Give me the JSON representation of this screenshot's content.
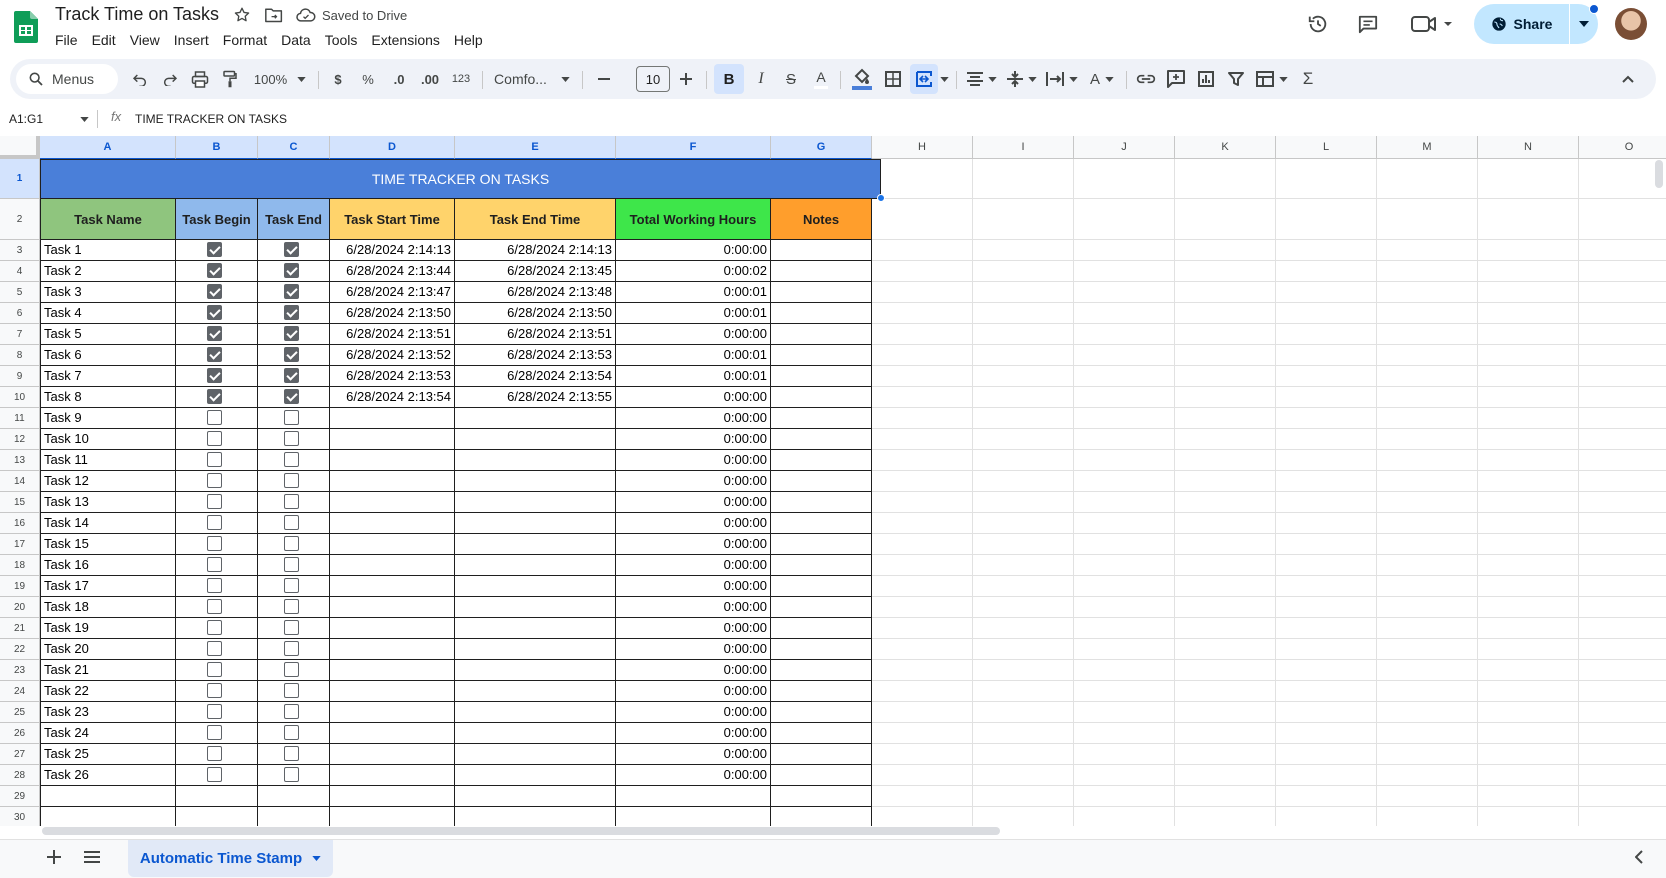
{
  "app": {
    "title": "Track Time on Tasks",
    "save_status": "Saved to Drive",
    "menus": [
      "File",
      "Edit",
      "View",
      "Insert",
      "Format",
      "Data",
      "Tools",
      "Extensions",
      "Help"
    ],
    "share_label": "Share"
  },
  "toolbar": {
    "search_label": "Menus",
    "zoom": "100%",
    "currency": "$",
    "percent": "%",
    "decrease_decimal": ".0",
    "increase_decimal": ".00",
    "number_format": "123",
    "font": "Comfo...",
    "font_size": "10"
  },
  "formula_bar": {
    "name_box": "A1:G1",
    "fx": "fx",
    "formula": "TIME TRACKER ON TASKS"
  },
  "columns": [
    "A",
    "B",
    "C",
    "D",
    "E",
    "F",
    "G",
    "H",
    "I",
    "J",
    "K",
    "L",
    "M",
    "N",
    "O"
  ],
  "row_numbers": [
    "1",
    "2",
    "3",
    "4",
    "5",
    "6",
    "7",
    "8",
    "9",
    "10",
    "11",
    "12",
    "13",
    "14",
    "15",
    "16",
    "17",
    "18",
    "19",
    "20",
    "21",
    "22",
    "23",
    "24",
    "25",
    "26",
    "27",
    "28",
    "29",
    "30"
  ],
  "sheet": {
    "title": "TIME TRACKER ON TASKS",
    "headers": [
      "Task Name",
      "Task Begin",
      "Task End",
      "Task Start Time",
      "Task End Time",
      "Total Working Hours",
      "Notes"
    ],
    "header_colors": [
      "#8fc57e",
      "#8fb9ec",
      "#8fb9ec",
      "#ffd36b",
      "#ffd36b",
      "#3ee64a",
      "#ff9e2c"
    ],
    "rows": [
      {
        "name": "Task 1",
        "begin": true,
        "end": true,
        "start": "6/28/2024 2:14:13",
        "endtime": "6/28/2024 2:14:13",
        "total": "0:00:00",
        "notes": ""
      },
      {
        "name": "Task 2",
        "begin": true,
        "end": true,
        "start": "6/28/2024 2:13:44",
        "endtime": "6/28/2024 2:13:45",
        "total": "0:00:02",
        "notes": ""
      },
      {
        "name": "Task 3",
        "begin": true,
        "end": true,
        "start": "6/28/2024 2:13:47",
        "endtime": "6/28/2024 2:13:48",
        "total": "0:00:01",
        "notes": ""
      },
      {
        "name": "Task 4",
        "begin": true,
        "end": true,
        "start": "6/28/2024 2:13:50",
        "endtime": "6/28/2024 2:13:50",
        "total": "0:00:01",
        "notes": ""
      },
      {
        "name": "Task 5",
        "begin": true,
        "end": true,
        "start": "6/28/2024 2:13:51",
        "endtime": "6/28/2024 2:13:51",
        "total": "0:00:00",
        "notes": ""
      },
      {
        "name": "Task 6",
        "begin": true,
        "end": true,
        "start": "6/28/2024 2:13:52",
        "endtime": "6/28/2024 2:13:53",
        "total": "0:00:01",
        "notes": ""
      },
      {
        "name": "Task 7",
        "begin": true,
        "end": true,
        "start": "6/28/2024 2:13:53",
        "endtime": "6/28/2024 2:13:54",
        "total": "0:00:01",
        "notes": ""
      },
      {
        "name": "Task 8",
        "begin": true,
        "end": true,
        "start": "6/28/2024 2:13:54",
        "endtime": "6/28/2024 2:13:55",
        "total": "0:00:00",
        "notes": ""
      },
      {
        "name": "Task 9",
        "begin": false,
        "end": false,
        "start": "",
        "endtime": "",
        "total": "0:00:00",
        "notes": ""
      },
      {
        "name": "Task 10",
        "begin": false,
        "end": false,
        "start": "",
        "endtime": "",
        "total": "0:00:00",
        "notes": ""
      },
      {
        "name": "Task 11",
        "begin": false,
        "end": false,
        "start": "",
        "endtime": "",
        "total": "0:00:00",
        "notes": ""
      },
      {
        "name": "Task 12",
        "begin": false,
        "end": false,
        "start": "",
        "endtime": "",
        "total": "0:00:00",
        "notes": ""
      },
      {
        "name": "Task 13",
        "begin": false,
        "end": false,
        "start": "",
        "endtime": "",
        "total": "0:00:00",
        "notes": ""
      },
      {
        "name": "Task 14",
        "begin": false,
        "end": false,
        "start": "",
        "endtime": "",
        "total": "0:00:00",
        "notes": ""
      },
      {
        "name": "Task 15",
        "begin": false,
        "end": false,
        "start": "",
        "endtime": "",
        "total": "0:00:00",
        "notes": ""
      },
      {
        "name": "Task 16",
        "begin": false,
        "end": false,
        "start": "",
        "endtime": "",
        "total": "0:00:00",
        "notes": ""
      },
      {
        "name": "Task 17",
        "begin": false,
        "end": false,
        "start": "",
        "endtime": "",
        "total": "0:00:00",
        "notes": ""
      },
      {
        "name": "Task 18",
        "begin": false,
        "end": false,
        "start": "",
        "endtime": "",
        "total": "0:00:00",
        "notes": ""
      },
      {
        "name": "Task 19",
        "begin": false,
        "end": false,
        "start": "",
        "endtime": "",
        "total": "0:00:00",
        "notes": ""
      },
      {
        "name": "Task 20",
        "begin": false,
        "end": false,
        "start": "",
        "endtime": "",
        "total": "0:00:00",
        "notes": ""
      },
      {
        "name": "Task 21",
        "begin": false,
        "end": false,
        "start": "",
        "endtime": "",
        "total": "0:00:00",
        "notes": ""
      },
      {
        "name": "Task 22",
        "begin": false,
        "end": false,
        "start": "",
        "endtime": "",
        "total": "0:00:00",
        "notes": ""
      },
      {
        "name": "Task 23",
        "begin": false,
        "end": false,
        "start": "",
        "endtime": "",
        "total": "0:00:00",
        "notes": ""
      },
      {
        "name": "Task 24",
        "begin": false,
        "end": false,
        "start": "",
        "endtime": "",
        "total": "0:00:00",
        "notes": ""
      },
      {
        "name": "Task 25",
        "begin": false,
        "end": false,
        "start": "",
        "endtime": "",
        "total": "0:00:00",
        "notes": ""
      },
      {
        "name": "Task 26",
        "begin": false,
        "end": false,
        "start": "",
        "endtime": "",
        "total": "0:00:00",
        "notes": ""
      }
    ]
  },
  "bottom": {
    "sheet_tab": "Automatic Time Stamp"
  },
  "colors": {
    "title_bg": "#4a7fd9",
    "accent": "#0b57d0",
    "share_bg": "#c2e7ff",
    "toolbar_bg": "#eff2f8"
  }
}
